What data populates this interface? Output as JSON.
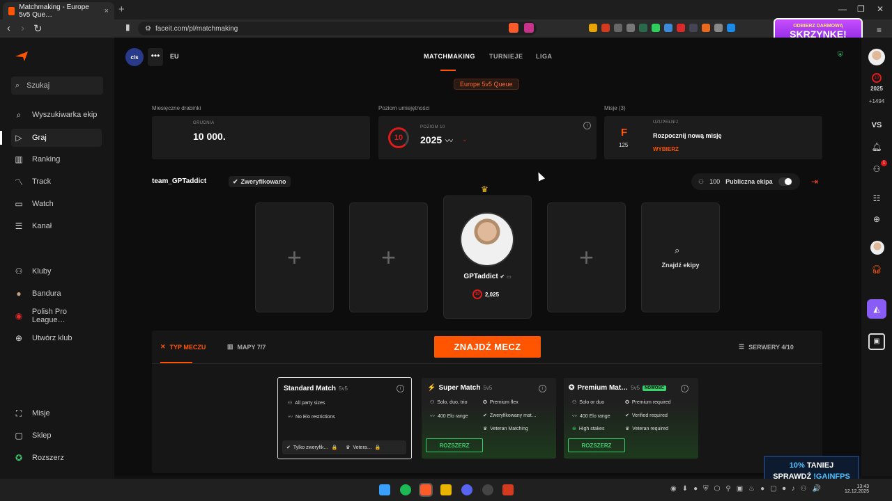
{
  "browser": {
    "tab_title": "Matchmaking - Europe 5v5 Que…",
    "url": "faceit.com/pl/matchmaking"
  },
  "promo_top": {
    "line1": "ODBIERZ DARMOWĄ",
    "line2": "SKRZYNKĘ!"
  },
  "promo_bottom": {
    "line1_pct": "10%",
    "line1_rest": " TANIEJ",
    "line2": "SPRAWDŹ ",
    "code": "!GAINFPS"
  },
  "sidebar": {
    "search": "Szukaj",
    "items": [
      {
        "label": "Wyszukiwarka ekip",
        "icon": "⌕"
      },
      {
        "label": "Graj",
        "icon": "▷"
      },
      {
        "label": "Ranking",
        "icon": "▥"
      },
      {
        "label": "Track",
        "icon": "〽"
      },
      {
        "label": "Watch",
        "icon": "▭"
      },
      {
        "label": "Kanał",
        "icon": "☰"
      }
    ],
    "clubs": [
      {
        "label": "Kluby",
        "icon": "⚇"
      },
      {
        "label": "Bandura",
        "icon": "●"
      },
      {
        "label": "Polish Pro League…",
        "icon": "◉"
      },
      {
        "label": "Utwórz klub",
        "icon": "⊕"
      }
    ],
    "bottom": [
      {
        "label": "Misje",
        "icon": "⛶"
      },
      {
        "label": "Sklep",
        "icon": "▢"
      },
      {
        "label": "Rozszerz",
        "icon": "✪"
      }
    ]
  },
  "header": {
    "badge": "c/s",
    "region": "EU",
    "tabs": [
      "MATCHMAKING",
      "TURNIEJE",
      "LIGA"
    ],
    "queue": "Europe 5v5 Queue"
  },
  "stats": {
    "monthly": {
      "label": "Miesięczne drabinki",
      "cap": "GRUDNIA",
      "value": "10 000."
    },
    "skill": {
      "label": "Poziom umiejętności",
      "cap": "POZIOM 10",
      "value": "2025",
      "level": "10"
    },
    "missions": {
      "label": "Misje (3)",
      "cap": "UZUPEŁNIJ",
      "text": "Rozpocznij nową misję",
      "action": "WYBIERZ",
      "grade": "F",
      "count": "125"
    }
  },
  "team": {
    "name": "team_GPTaddict",
    "verified": "Zweryfikowano",
    "count": "100",
    "public_label": "Publiczna ekipa"
  },
  "player": {
    "name": "GPTaddict",
    "level": "10",
    "elo": "2,025"
  },
  "find_party": "Znajdź ekipy",
  "panel": {
    "tab_type": "TYP MECZU",
    "tab_maps": "MAPY 7/7",
    "find_match": "ZNAJDŹ MECZ",
    "servers": "SERWERY 4/10"
  },
  "matches": [
    {
      "title": "Standard Match",
      "sub": "5v5",
      "features": [
        "All party sizes",
        "No Elo restrictions"
      ],
      "filters": [
        "Tylko zweryfik…",
        "Vetera…"
      ]
    },
    {
      "title": "Super Match",
      "sub": "5v5",
      "features": [
        "Solo, duo, trio",
        "400 Elo range"
      ],
      "features2": [
        "Premium flex",
        "Zweryfikowany mat…",
        "Veteran Matching"
      ],
      "button": "ROZSZERZ"
    },
    {
      "title": "Premium Mat…",
      "sub": "5v5",
      "new": "NOWOŚĆ",
      "features": [
        "Solo or duo",
        "400 Elo range",
        "High stakes"
      ],
      "features2": [
        "Premium required",
        "Verified required",
        "Veteran required"
      ],
      "button": "ROZSZERZ"
    }
  ],
  "rail": {
    "elo": "2025",
    "gain": "+1494",
    "vs": "VS",
    "notif": "1"
  },
  "taskbar": {
    "time": "13:43",
    "date": "12.12.2025"
  }
}
